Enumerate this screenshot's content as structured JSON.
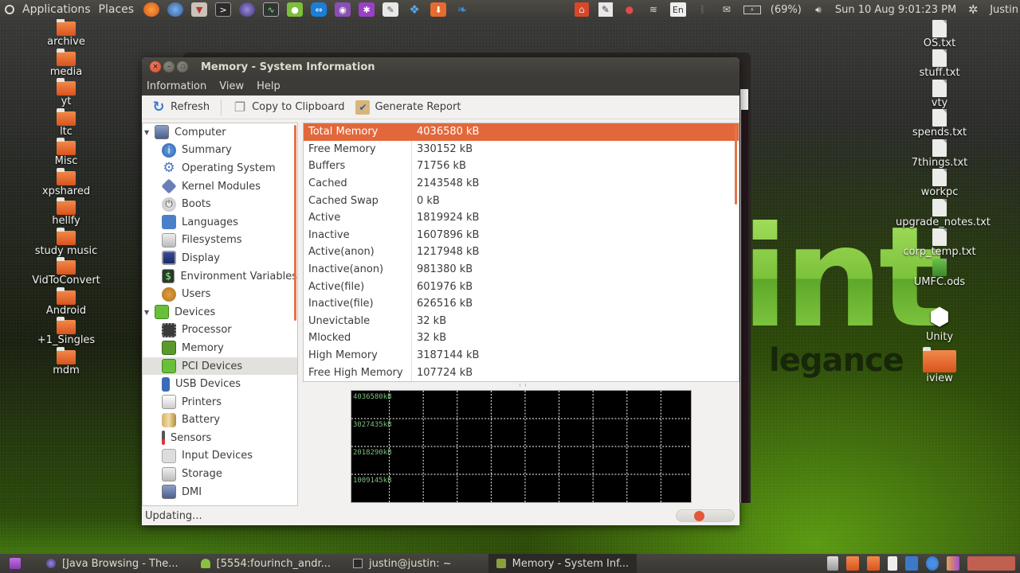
{
  "top_panel": {
    "menus": [
      "Applications",
      "Places"
    ],
    "launchers": [
      "firefox-icon",
      "thunderbird-icon",
      "package-installer-icon",
      "terminal-icon",
      "eclipse-icon",
      "system-monitor-icon",
      "android-icon",
      "teamviewer-icon",
      "media-player-icon",
      "settings-icon",
      "text-editor-icon",
      "dropbox-icon",
      "file-manager-icon",
      "app-icon"
    ],
    "battery_percent": "(69%)",
    "keyboard_layout": "En",
    "datetime": "Sun 10 Aug  9:01:23 PM",
    "user": "Justin"
  },
  "desktop_left": [
    "archive",
    "media",
    "yt",
    "ltc",
    "Misc",
    "xpshared",
    "hellfy",
    "study music",
    "VidToConvert",
    "Android",
    "+1_Singles",
    "mdm"
  ],
  "desktop_right": [
    {
      "label": "OS.txt",
      "type": "doc"
    },
    {
      "label": "stuff.txt",
      "type": "doc"
    },
    {
      "label": "vty",
      "type": "doc"
    },
    {
      "label": "spends.txt",
      "type": "doc"
    },
    {
      "label": "7things.txt",
      "type": "doc"
    },
    {
      "label": "workpc",
      "type": "doc"
    },
    {
      "label": "upgrade_notes.txt",
      "type": "doc"
    },
    {
      "label": "corp_temp.txt",
      "type": "doc"
    },
    {
      "label": "UMFC.ods",
      "type": "sheet"
    },
    {
      "label": "Unity",
      "type": "unity"
    },
    {
      "label": "iview",
      "type": "folder"
    }
  ],
  "wallpaper": {
    "logo": "int",
    "tagline": "legance"
  },
  "window": {
    "title": "Memory - System Information",
    "menus": [
      "Information",
      "View",
      "Help"
    ],
    "toolbar": {
      "refresh": "Refresh",
      "copy": "Copy to Clipboard",
      "report": "Generate Report"
    },
    "tree": [
      {
        "label": "Computer",
        "type": "cat",
        "icon": "computer-icon"
      },
      {
        "label": "Summary",
        "type": "child",
        "icon": "info-icon"
      },
      {
        "label": "Operating System",
        "type": "child",
        "icon": "gear-icon"
      },
      {
        "label": "Kernel Modules",
        "type": "child",
        "icon": "kernel-module-icon"
      },
      {
        "label": "Boots",
        "type": "child",
        "icon": "power-icon"
      },
      {
        "label": "Languages",
        "type": "child",
        "icon": "flag-icon"
      },
      {
        "label": "Filesystems",
        "type": "child",
        "icon": "drive-icon"
      },
      {
        "label": "Display",
        "type": "child",
        "icon": "monitor-icon"
      },
      {
        "label": "Environment Variables",
        "type": "child",
        "icon": "terminal-icon"
      },
      {
        "label": "Users",
        "type": "child",
        "icon": "users-icon"
      },
      {
        "label": "Devices",
        "type": "cat",
        "icon": "devices-icon"
      },
      {
        "label": "Processor",
        "type": "child",
        "icon": "cpu-icon"
      },
      {
        "label": "Memory",
        "type": "child",
        "icon": "memory-icon"
      },
      {
        "label": "PCI Devices",
        "type": "child",
        "icon": "pci-icon",
        "selected": true
      },
      {
        "label": "USB Devices",
        "type": "child",
        "icon": "usb-icon"
      },
      {
        "label": "Printers",
        "type": "child",
        "icon": "printer-icon"
      },
      {
        "label": "Battery",
        "type": "child",
        "icon": "battery-icon"
      },
      {
        "label": "Sensors",
        "type": "child",
        "icon": "thermometer-icon"
      },
      {
        "label": "Input Devices",
        "type": "child",
        "icon": "input-devices-icon"
      },
      {
        "label": "Storage",
        "type": "child",
        "icon": "storage-icon"
      },
      {
        "label": "DMI",
        "type": "child",
        "icon": "dmi-icon"
      }
    ],
    "details": [
      {
        "key": "Total Memory",
        "value": "4036580 kB",
        "selected": true
      },
      {
        "key": "Free Memory",
        "value": "330152 kB"
      },
      {
        "key": "Buffers",
        "value": "71756 kB"
      },
      {
        "key": "Cached",
        "value": "2143548 kB"
      },
      {
        "key": "Cached Swap",
        "value": "0 kB"
      },
      {
        "key": "Active",
        "value": "1819924 kB"
      },
      {
        "key": "Inactive",
        "value": "1607896 kB"
      },
      {
        "key": "Active(anon)",
        "value": "1217948 kB"
      },
      {
        "key": "Inactive(anon)",
        "value": "981380 kB"
      },
      {
        "key": "Active(file)",
        "value": "601976 kB"
      },
      {
        "key": "Inactive(file)",
        "value": "626516 kB"
      },
      {
        "key": "Unevictable",
        "value": "32 kB"
      },
      {
        "key": "Mlocked",
        "value": "32 kB"
      },
      {
        "key": "High Memory",
        "value": "3187144 kB"
      },
      {
        "key": "Free High Memory",
        "value": "107724 kB"
      }
    ],
    "graph": {
      "labels": [
        "4036580kB",
        "3027435kB",
        "2018290kB",
        "1009145kB"
      ],
      "label_color": "#7fbf7f",
      "grid_color": "#ffffff",
      "columns": 10,
      "rows": 4
    },
    "status": "Updating...",
    "accent": "#e2683c"
  },
  "taskbar": {
    "tasks": [
      {
        "label": "[Java Browsing - The...",
        "icon": "eclipse-icon"
      },
      {
        "label": "[5554:fourinch_andr...",
        "icon": "android-icon"
      },
      {
        "label": "justin@justin: ~",
        "icon": "terminal-icon"
      },
      {
        "label": "Memory - System Inf...",
        "icon": "hardinfo-icon",
        "active": true
      }
    ]
  }
}
